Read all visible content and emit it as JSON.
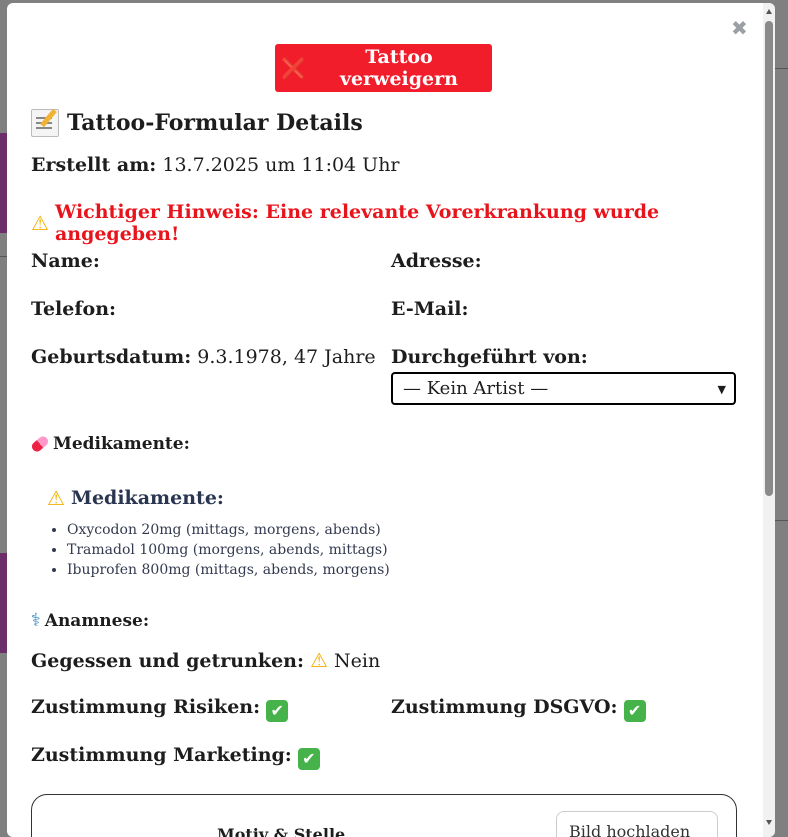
{
  "modal": {
    "reject_button": "Tattoo verweigern",
    "title": "Tattoo-Formular Details",
    "created_label": "Erstellt am:",
    "created_value": "13.7.2025 um 11:04 Uhr",
    "warning": "Wichtiger Hinweis: Eine relevante Vorerkrankung wurde angegeben!",
    "name_label": "Name:",
    "address_label": "Adresse:",
    "phone_label": "Telefon:",
    "email_label": "E-Mail:",
    "birth_label": "Geburtsdatum:",
    "birth_value": "9.3.1978, 47 Jahre",
    "performed_label": "Durchgeführt von:",
    "artist_select": "— Kein Artist —",
    "meds_section": "Medikamente:",
    "meds_heading": "Medikamente:",
    "meds": [
      "Oxycodon 20mg (mittags, morgens, abends)",
      "Tramadol 100mg (morgens, abends, mittags)",
      "Ibuprofen 800mg (mittags, abends, morgens)"
    ],
    "anamnesis_section": "Anamnese:",
    "ate_label": "Gegessen und getrunken:",
    "ate_value": "Nein",
    "consent_risks_label": "Zustimmung Risiken:",
    "consent_gdpr_label": "Zustimmung DSGVO:",
    "consent_marketing_label": "Zustimmung Marketing:",
    "bottom_box_label": "Motiv & Stelle",
    "bottom_box_button": "Bild hochladen"
  },
  "icons": {
    "close": "close-icon",
    "reject": "cross-mark-icon",
    "title": "memo-icon",
    "warning": "warning-icon",
    "meds": "pill-icon",
    "anamnesis": "stethoscope-icon",
    "check": "check-mark-icon"
  },
  "colors": {
    "reject_button": "#f21d2b",
    "warning_text": "#e8141c",
    "check": "#46b34a"
  }
}
